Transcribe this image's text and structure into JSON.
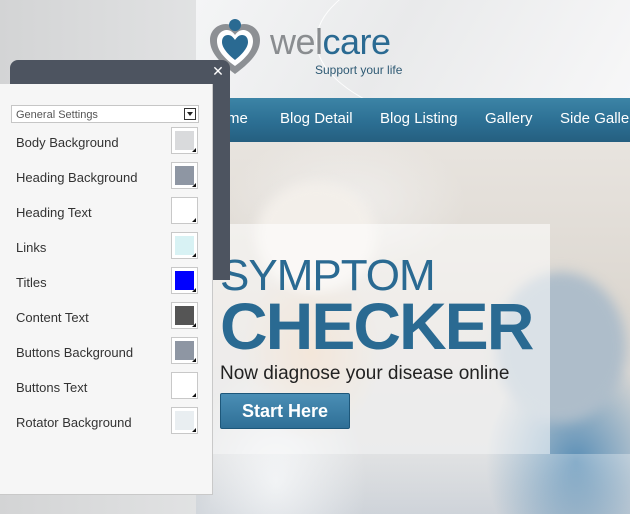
{
  "site": {
    "logo_wel": "wel",
    "logo_care": "care",
    "tagline": "Support your life",
    "nav": [
      "me",
      "Blog Detail",
      "Blog Listing",
      "Gallery",
      "Side Galler"
    ],
    "hero": {
      "title_line1": "SYMPTOM",
      "title_line2": "CHECKER",
      "subtitle": "Now diagnose your disease online",
      "button_label": "Start Here"
    }
  },
  "settings_panel": {
    "close_glyph": "✕",
    "dropdown_value": "General Settings",
    "options": [
      {
        "label": "Body Background",
        "color": "#d9dadc"
      },
      {
        "label": "Heading Background",
        "color": "#8e96a3"
      },
      {
        "label": "Heading Text",
        "color": "#ffffff"
      },
      {
        "label": "Links",
        "color": "#d8f2f4"
      },
      {
        "label": "Titles",
        "color": "#0000ff"
      },
      {
        "label": "Content Text",
        "color": "#555555"
      },
      {
        "label": "Buttons Background",
        "color": "#8e96a3"
      },
      {
        "label": "Buttons Text",
        "color": "#ffffff"
      },
      {
        "label": "Rotator Background",
        "color": "#e9eef1"
      }
    ]
  },
  "colors": {
    "brand_blue": "#2a6a92",
    "panel_dark": "#4d5460"
  }
}
